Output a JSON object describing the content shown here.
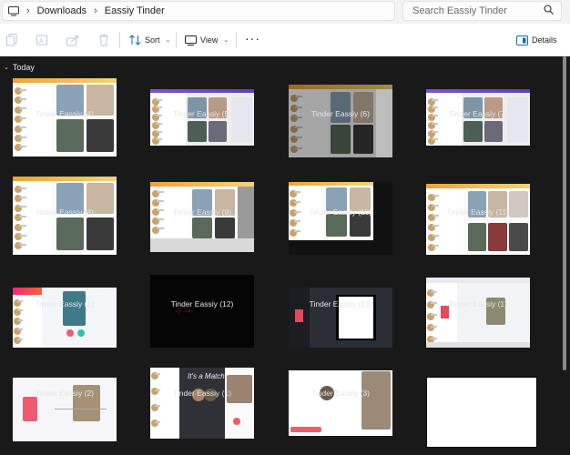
{
  "address": {
    "crumbs": [
      "Downloads",
      "Eassiy Tinder"
    ]
  },
  "search": {
    "placeholder": "Search Eassiy Tinder"
  },
  "toolbar": {
    "sort_label": "Sort",
    "view_label": "View",
    "details_label": "Details"
  },
  "group": {
    "label": "Today"
  },
  "files": [
    {
      "name": "Tinder Eassiy (4)"
    },
    {
      "name": "Tinder Eassiy (5)"
    },
    {
      "name": "Tinder Eassiy (6)"
    },
    {
      "name": "Tinder Eassiy (7)"
    },
    {
      "name": "Tinder Eassiy (8)"
    },
    {
      "name": "Tinder Eassiy (9)"
    },
    {
      "name": "Tinder Eassiy (10)"
    },
    {
      "name": "Tinder Eassiy (11)"
    },
    {
      "name": "Tinder Eassiy (1)"
    },
    {
      "name": "Tinder Eassiy (12)"
    },
    {
      "name": "Tinder Eassiy (13)"
    },
    {
      "name": "Tinder Eassiy (1)"
    },
    {
      "name": "Tinder Eassiy (2)"
    },
    {
      "name": "Tinder Eassiy (1)"
    },
    {
      "name": "Tinder Eassiy (3)"
    },
    {
      "name": ""
    }
  ],
  "colors": {
    "background": "#191919",
    "accent": "#0067c0",
    "tinder_pink": "#fe3c72"
  }
}
